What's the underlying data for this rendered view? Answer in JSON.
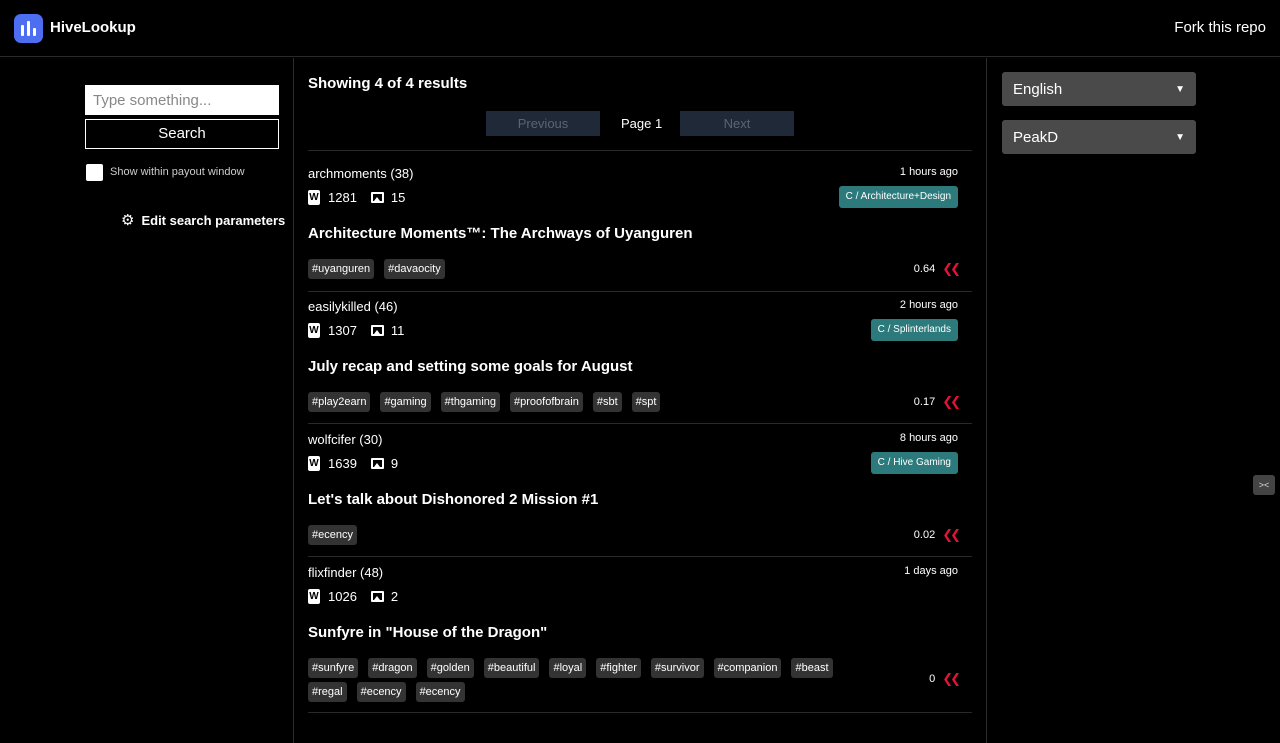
{
  "header": {
    "brand": "HiveLookup",
    "fork": "Fork this repo"
  },
  "search": {
    "placeholder": "Type something...",
    "button": "Search",
    "payout_label": "Show within payout window",
    "edit_label": "Edit search parameters"
  },
  "results": {
    "summary": "Showing 4 of 4 results",
    "previous": "Previous",
    "page": "Page 1",
    "next": "Next"
  },
  "settings": {
    "language": "English",
    "frontend": "PeakD"
  },
  "posts": [
    {
      "author": "archmoments (38)",
      "time": "1 hours ago",
      "words": "1281",
      "images": "15",
      "community": "C / Architecture+Design",
      "title": "Architecture Moments™: The Archways of Uyanguren",
      "tags": [
        "#uyanguren",
        "#davaocity"
      ],
      "payout": "0.64"
    },
    {
      "author": "easilykilled (46)",
      "time": "2 hours ago",
      "words": "1307",
      "images": "11",
      "community": "C / Splinterlands",
      "title": "July recap and setting some goals for August",
      "tags": [
        "#play2earn",
        "#gaming",
        "#thgaming",
        "#proofofbrain",
        "#sbt",
        "#spt"
      ],
      "payout": "0.17"
    },
    {
      "author": "wolfcifer (30)",
      "time": "8 hours ago",
      "words": "1639",
      "images": "9",
      "community": "C / Hive Gaming",
      "title": "Let's talk about Dishonored 2 Mission #1",
      "tags": [
        "#ecency"
      ],
      "payout": "0.02"
    },
    {
      "author": "flixfinder (48)",
      "time": "1 days ago",
      "words": "1026",
      "images": "2",
      "community": "",
      "title": "Sunfyre in \"House of the Dragon\"",
      "tags": [
        "#sunfyre",
        "#dragon",
        "#golden",
        "#beautiful",
        "#loyal",
        "#fighter",
        "#survivor",
        "#companion",
        "#beast",
        "#regal",
        "#ecency",
        "#ecency"
      ],
      "payout": "0"
    }
  ]
}
